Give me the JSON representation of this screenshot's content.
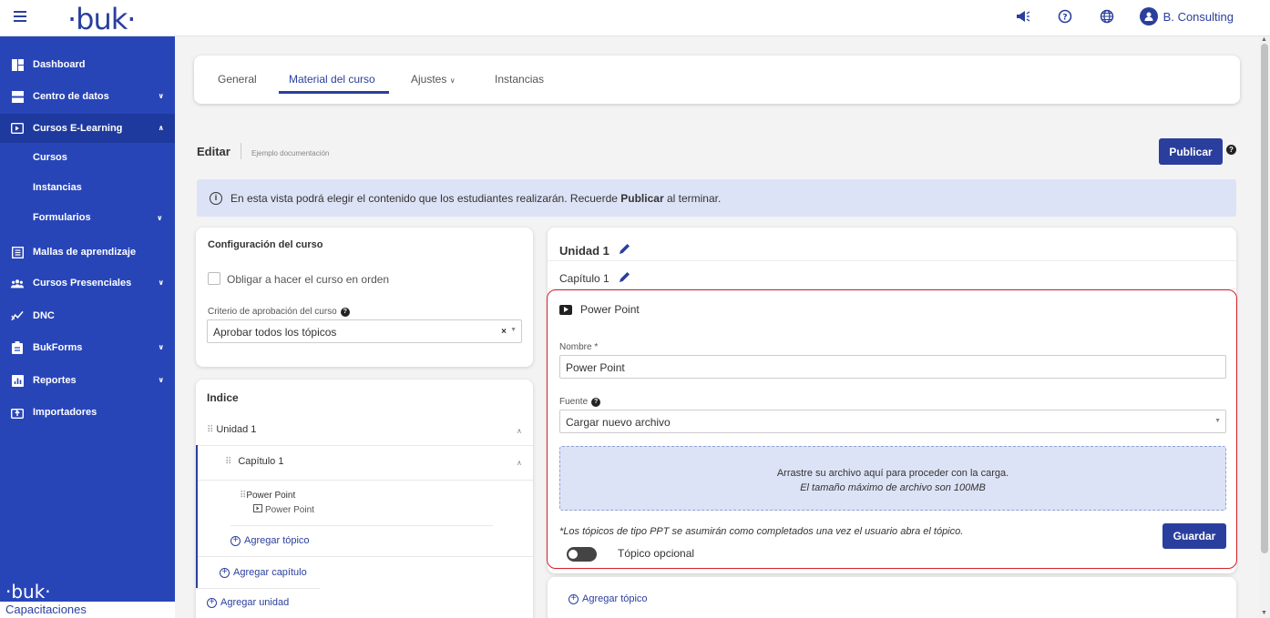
{
  "topbar": {
    "logo": "·buk·",
    "user_name": "B. Consulting",
    "icons": [
      "menu-icon",
      "megaphone-icon",
      "help-icon",
      "globe-icon",
      "user-icon"
    ]
  },
  "sidebar": {
    "items": [
      {
        "label": "Dashboard",
        "icon": "dashboard-icon"
      },
      {
        "label": "Centro de datos",
        "icon": "server-icon"
      },
      {
        "label": "Cursos E-Learning",
        "icon": "play-icon"
      },
      {
        "label": "Mallas de aprendizaje",
        "icon": "book-icon"
      },
      {
        "label": "Cursos Presenciales",
        "icon": "users-icon"
      },
      {
        "label": "DNC",
        "icon": "chart-line-icon"
      },
      {
        "label": "BukForms",
        "icon": "clipboard-icon"
      },
      {
        "label": "Reportes",
        "icon": "bar-chart-icon"
      },
      {
        "label": "Importadores",
        "icon": "import-icon"
      }
    ],
    "subitems": [
      "Cursos",
      "Instancias",
      "Formularios"
    ],
    "footer_logo": "·buk·",
    "footer_label": "Capacitaciones"
  },
  "tabs": [
    "General",
    "Material del curso",
    "Ajustes",
    "Instancias"
  ],
  "edit": {
    "title": "Editar",
    "subtitle": "Ejemplo documentación",
    "publish_label": "Publicar"
  },
  "info": {
    "text_before": "En esta vista podrá elegir el contenido que los estudiantes realizarán. Recuerde ",
    "text_bold": "Publicar",
    "text_after": " al terminar."
  },
  "config": {
    "title": "Configuración del curso",
    "checkbox_label": "Obligar a hacer el curso en orden",
    "criteria_label": "Criterio de aprobación del curso",
    "criteria_value": "Aprobar todos los tópicos"
  },
  "index": {
    "title": "Indice",
    "unit": "Unidad 1",
    "chapter": "Capítulo 1",
    "topic": "Power Point",
    "topic_type": "Power Point",
    "add_topic": "Agregar tópico",
    "add_chapter": "Agregar capítulo",
    "add_unit": "Agregar unidad"
  },
  "unit_panel": {
    "unit_title": "Unidad 1",
    "chapter_title": "Capítulo 1",
    "topic_header": "Power Point",
    "name_label": "Nombre *",
    "name_value": "Power Point",
    "source_label": "Fuente",
    "source_value": "Cargar nuevo archivo",
    "drop_line1": "Arrastre su archivo aquí para proceder con la carga.",
    "drop_line2": "El tamaño máximo de archivo son 100MB",
    "note": "*Los tópicos de tipo PPT se asumirán como completados una vez el usuario abra el tópico.",
    "save_label": "Guardar",
    "optional_label": "Tópico opcional",
    "add_topic": "Agregar tópico"
  },
  "colors": {
    "brand": "#2a3f9d",
    "sidebar": "#2845b8",
    "highlight_border": "#d6202a",
    "info_bg": "#dde3f6"
  }
}
